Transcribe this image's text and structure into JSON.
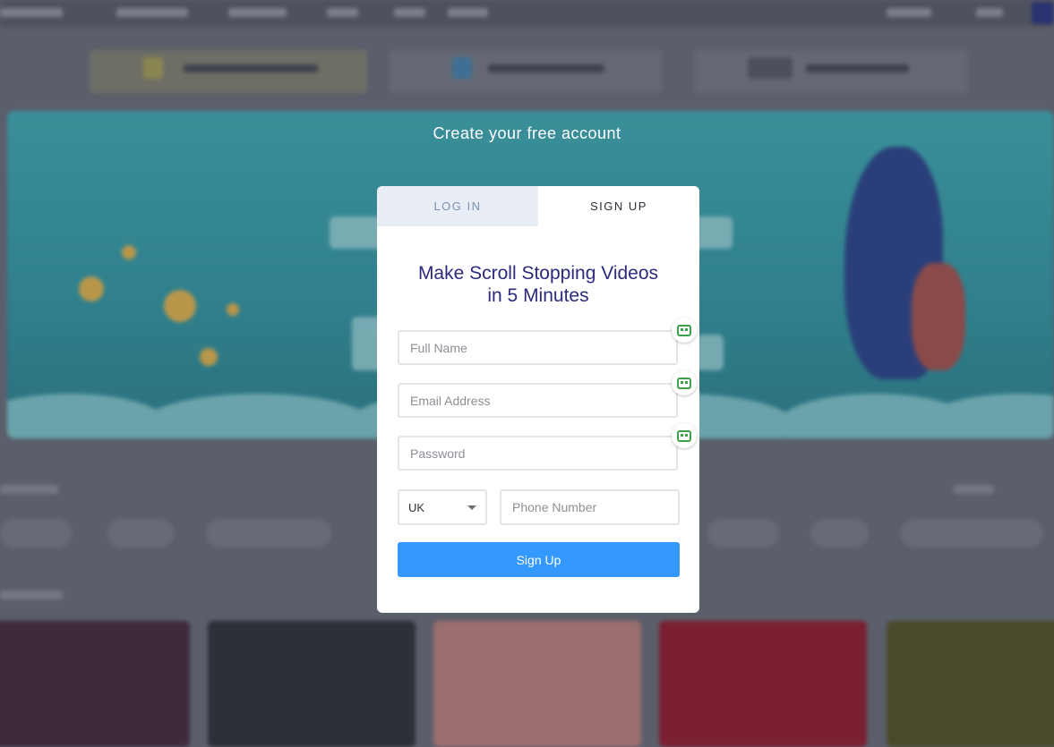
{
  "headline": "Create your free account",
  "tabs": {
    "login": "LOG IN",
    "signup": "SIGN UP",
    "active": "signup"
  },
  "form": {
    "title_line1": "Make Scroll Stopping Videos",
    "title_line2": "in 5 Minutes",
    "full_name_placeholder": "Full Name",
    "email_placeholder": "Email Address",
    "password_placeholder": "Password",
    "country_value": "UK",
    "phone_placeholder": "Phone Number",
    "submit_label": "Sign Up"
  },
  "colors": {
    "accent": "#3399ff",
    "title": "#2b2a7e",
    "overlay": "#5b5f6b",
    "autofill_icon": "#3da14a"
  },
  "icons": {
    "autofill": "password-manager-icon",
    "dropdown": "caret-down-icon"
  }
}
